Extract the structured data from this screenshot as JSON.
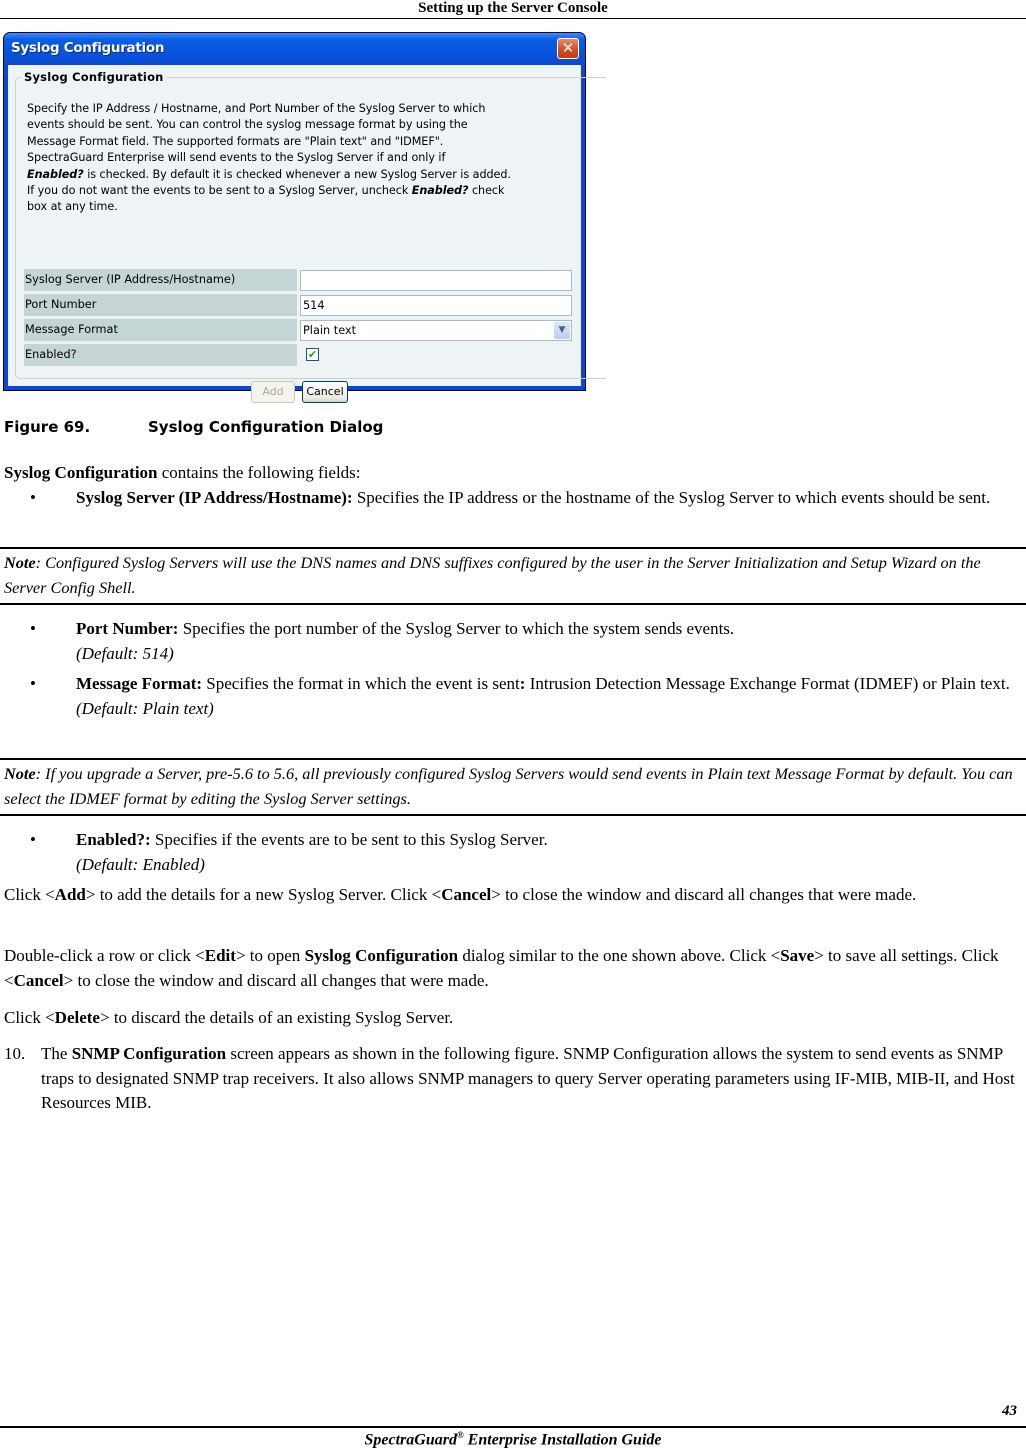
{
  "header": {
    "title": "Setting up the Server Console"
  },
  "dialog": {
    "title": "Syslog Configuration",
    "close_icon": "close-icon",
    "group_title": "Syslog Configuration",
    "description": {
      "line1": "Specify the IP Address / Hostname, and Port Number of the Syslog Server to which",
      "line2": "events should be sent. You can control the syslog message format by using the",
      "line3": "Message Format field. The supported formats are \"Plain text\" and \"IDMEF\".",
      "line4": "SpectraGuard Enterprise will send events to the Syslog Server if and only if",
      "line5_bold": "Enabled?",
      "line5_rest": " is checked. By default it is checked whenever a new Syslog Server is added.",
      "line6_pre": "If you do not want the events to be sent to a Syslog Server, uncheck ",
      "line6_bold": "Enabled?",
      "line6_post": " check",
      "line7": "box at any time."
    },
    "fields": {
      "server": {
        "label": "Syslog Server (IP Address/Hostname)",
        "value": ""
      },
      "port": {
        "label": "Port Number",
        "value": "514"
      },
      "format": {
        "label": "Message Format",
        "value": "Plain text",
        "icon": "chevron-down-icon"
      },
      "enabled": {
        "label": "Enabled?",
        "checked": true,
        "check_glyph": "✔"
      }
    },
    "buttons": {
      "add": "Add",
      "cancel": "Cancel"
    }
  },
  "figure": {
    "number": "Figure  69.",
    "title": "Syslog Configuration Dialog"
  },
  "intro": {
    "bold": "Syslog Configuration",
    "rest": " contains the following fields:"
  },
  "bullets": {
    "server": {
      "bold": "Syslog Server (IP Address/Hostname):",
      "text": " Specifies the IP address or the hostname of the Syslog Server to which events should be sent."
    },
    "port": {
      "bold": "Port Number:",
      "text": " Specifies the port number of the Syslog Server to which the system sends events.",
      "default": "(Default: 514)"
    },
    "format": {
      "bold": "Message Format:",
      "text": " Specifies the format in which the event is sent",
      "bold2": ":",
      "text2": " Intrusion Detection Message Exchange Format (IDMEF) or Plain text.",
      "default": "(Default: Plain text)"
    },
    "enabled": {
      "bold": "Enabled?:",
      "text": " Specifies if the events are to be sent to this Syslog Server.",
      "default": "(Default: Enabled)"
    }
  },
  "notes": {
    "dns": {
      "label": "Note",
      "text": ": Configured Syslog Servers will use the DNS names and DNS suffixes configured by the user in the Server Initialization and Setup Wizard on the Server Config Shell."
    },
    "upgrade": {
      "label": "Note",
      "text": ": If you upgrade a Server, pre-5.6 to 5.6, all previously configured Syslog Servers would send events in Plain text Message Format by default. You can select the IDMEF format by editing the Syslog Server settings."
    }
  },
  "paragraphs": {
    "add": {
      "p1": "Click <",
      "b1": "Add",
      "p2": "> to add the details for a new Syslog Server. Click <",
      "b2": "Cancel",
      "p3": "> to close the window and discard all changes that were made."
    },
    "edit": {
      "p1": "Double-click a row or click <",
      "b1": "Edit",
      "p2": "> to open ",
      "b2": "Syslog Configuration",
      "p3": " dialog similar to the one shown above. Click <",
      "b3": "Save",
      "p4": "> to save all settings. Click <",
      "b4": "Cancel",
      "p5": "> to close the window and discard all changes that were made."
    },
    "delete": {
      "p1": "Click <",
      "b1": "Delete",
      "p2": "> to discard the details of an existing Syslog Server."
    }
  },
  "step": {
    "number": "10.",
    "p1": "The ",
    "b1": "SNMP Configuration",
    "p2": " screen appears as shown in the following figure. SNMP Configuration allows the system to send events as SNMP traps to designated SNMP trap receivers. It also allows SNMP managers to query Server operating parameters using IF-MIB, MIB-II, and Host Resources MIB."
  },
  "footer": {
    "page_number": "43",
    "title_pre": "SpectraGuard",
    "reg": "®",
    "title_post": " Enterprise Installation Guide"
  }
}
